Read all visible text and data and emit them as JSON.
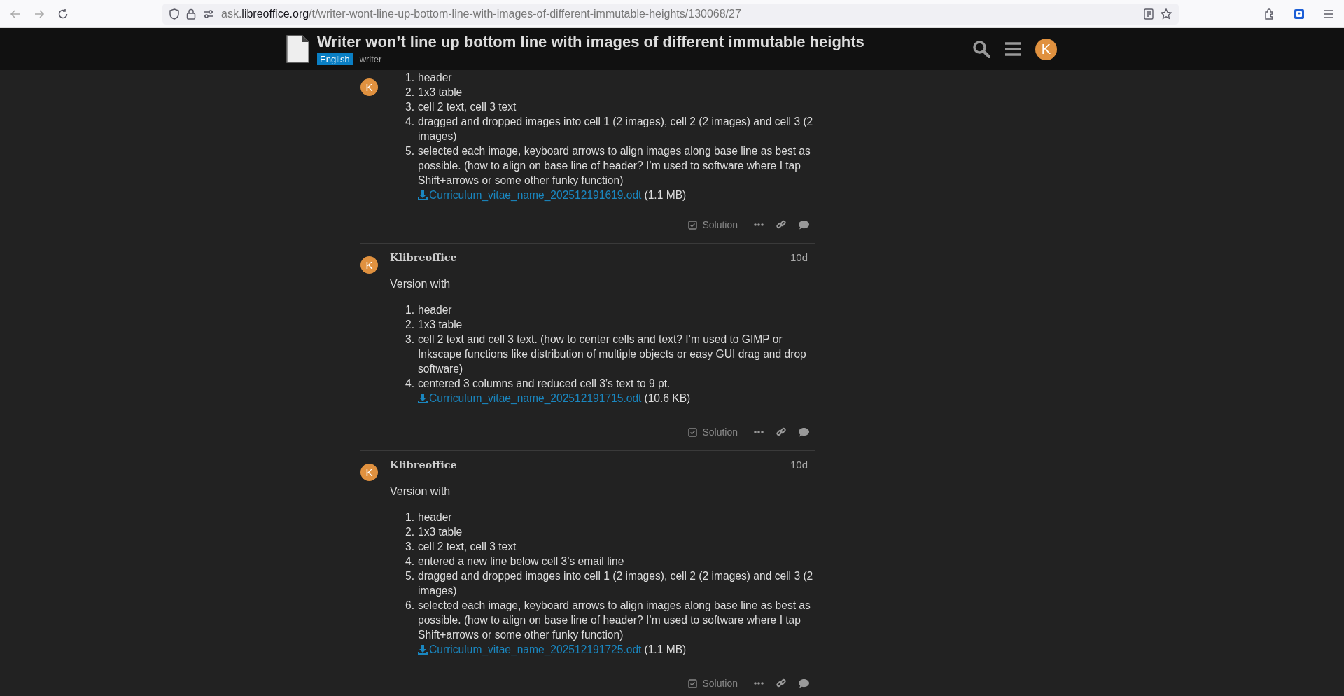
{
  "browser": {
    "url": {
      "prefix": "ask.",
      "domain": "libreoffice.org",
      "path": "/t/writer-wont-line-up-bottom-line-with-images-of-different-immutable-heights/130068/27"
    }
  },
  "header": {
    "title": "Writer won’t line up bottom line with images of different immutable heights",
    "category": "English",
    "tags": [
      "writer"
    ],
    "avatar_letter": "K"
  },
  "posts": [
    {
      "avatar_letter": "K",
      "items": [
        {
          "number": "1.",
          "text": "header"
        },
        {
          "number": "2.",
          "text": "1x3 table"
        },
        {
          "number": "3.",
          "text": "cell 2 text, cell 3 text"
        },
        {
          "number": "4.",
          "text": "dragged and dropped images into cell 1 (2 images), cell 2 (2 images) and cell 3 (2 images)"
        },
        {
          "number": "5.",
          "text": "selected each image, keyboard arrows to align images along base line as best as possible. (how to align on base line of header? I’m used to software where I tap Shift+arrows or some other funky function)"
        }
      ],
      "attachment": {
        "name": "Curriculum_vitae_name_202512191619.odt",
        "size": "(1.1 MB)"
      },
      "solution_label": "Solution"
    },
    {
      "avatar_letter": "K",
      "author": "Klibreoffice",
      "date": "10d",
      "intro": "Version with",
      "items": [
        {
          "number": "1.",
          "text": "header"
        },
        {
          "number": "2.",
          "text": "1x3 table"
        },
        {
          "number": "3.",
          "text": "cell 2 text and cell 3 text. (how to center cells and text? I’m used to GIMP or Inkscape functions like distribution of multiple objects or easy GUI drag and drop software)"
        },
        {
          "number": "4.",
          "text": "centered 3 columns and reduced cell 3’s text to 9 pt."
        }
      ],
      "attachment": {
        "name": "Curriculum_vitae_name_202512191715.odt",
        "size": "(10.6 KB)"
      },
      "solution_label": "Solution"
    },
    {
      "avatar_letter": "K",
      "author": "Klibreoffice",
      "date": "10d",
      "intro": "Version with",
      "items": [
        {
          "number": "1.",
          "text": "header"
        },
        {
          "number": "2.",
          "text": "1x3 table"
        },
        {
          "number": "3.",
          "text": "cell 2 text, cell 3 text"
        },
        {
          "number": "4.",
          "text": "entered a new line below cell 3’s email line"
        },
        {
          "number": "5.",
          "text": "dragged and dropped images into cell 1 (2 images), cell 2 (2 images) and cell 3 (2 images)"
        },
        {
          "number": "6.",
          "text": "selected each image, keyboard arrows to align images along base line as best as possible. (how to align on base line of header? I’m used to software where I tap Shift+arrows or some other funky function)"
        }
      ],
      "attachment": {
        "name": "Curriculum_vitae_name_202512191725.odt",
        "size": "(1.1 MB)"
      },
      "solution_label": "Solution"
    }
  ]
}
